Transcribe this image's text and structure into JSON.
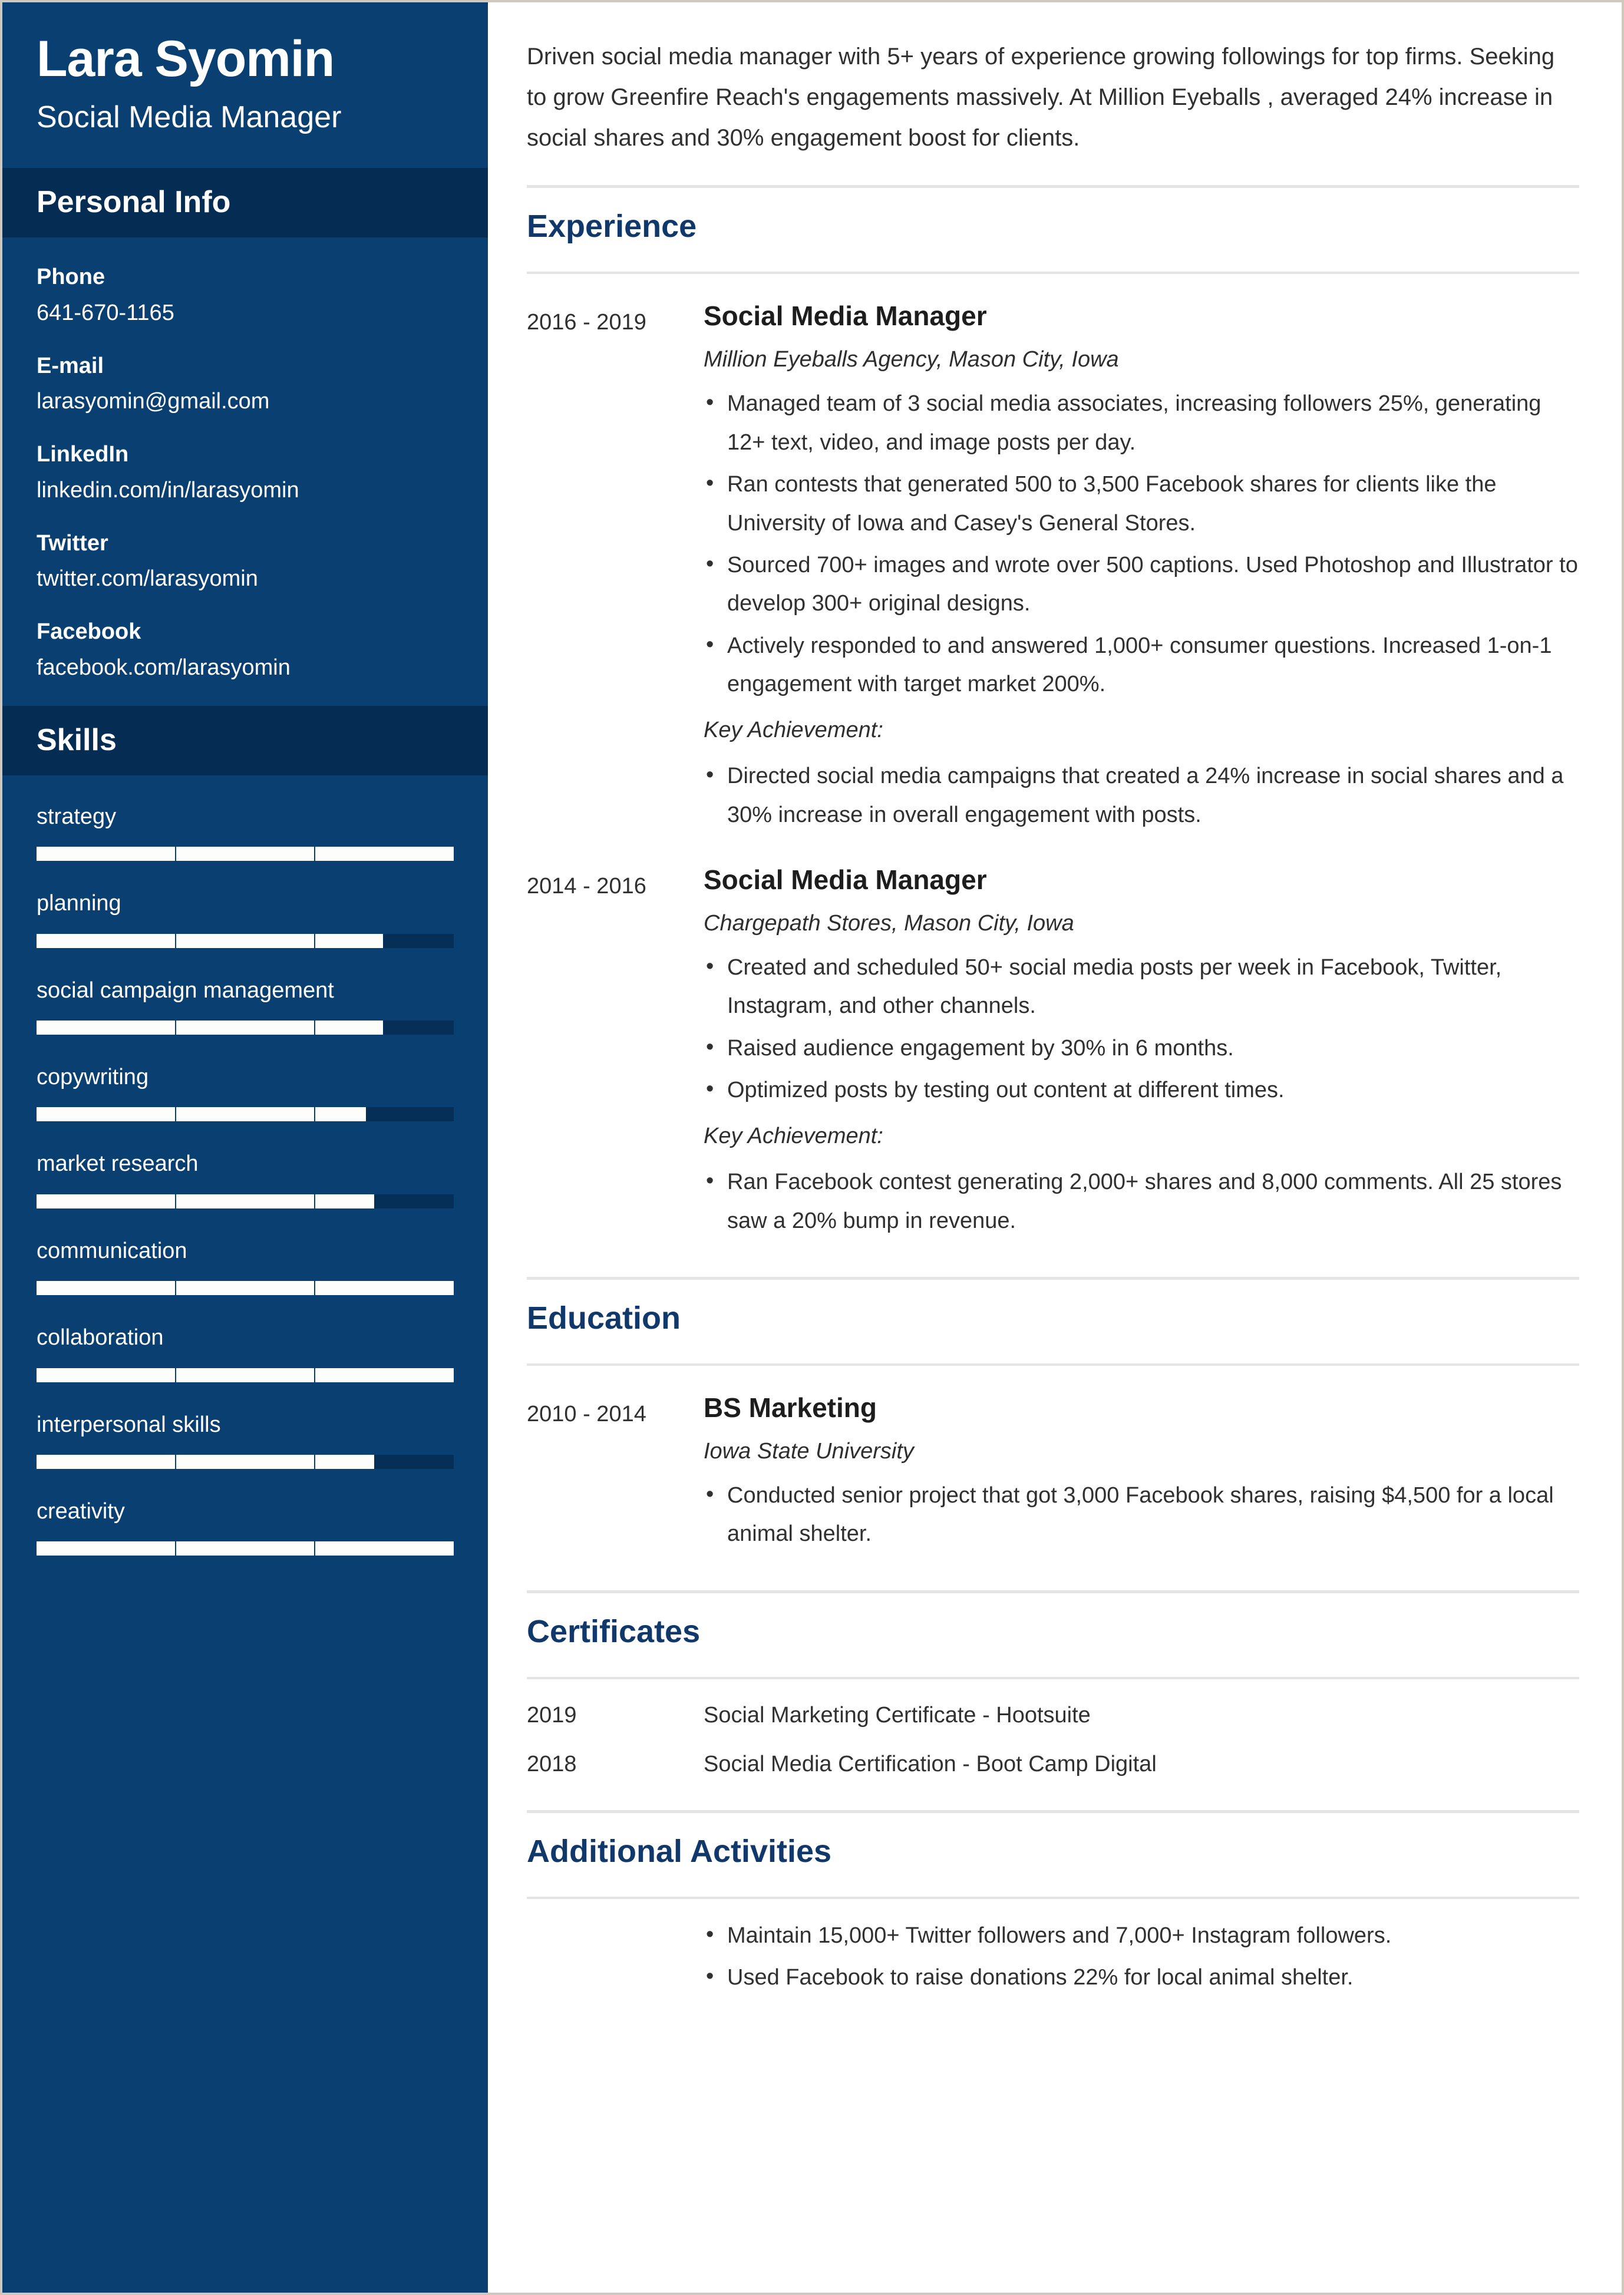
{
  "profile": {
    "name": "Lara Syomin",
    "role": "Social Media Manager"
  },
  "sidebar": {
    "personal_info_title": "Personal Info",
    "skills_title": "Skills",
    "contacts": [
      {
        "label": "Phone",
        "value": "641-670-1165"
      },
      {
        "label": "E-mail",
        "value": "larasyomin@gmail.com"
      },
      {
        "label": "LinkedIn",
        "value": "linkedin.com/in/larasyomin"
      },
      {
        "label": "Twitter",
        "value": "twitter.com/larasyomin"
      },
      {
        "label": "Facebook",
        "value": "facebook.com/larasyomin"
      }
    ],
    "skills": [
      {
        "name": "strategy",
        "level": 100
      },
      {
        "name": "planning",
        "level": 83
      },
      {
        "name": "social campaign management",
        "level": 83
      },
      {
        "name": "copywriting",
        "level": 79
      },
      {
        "name": "market research",
        "level": 81
      },
      {
        "name": "communication",
        "level": 100
      },
      {
        "name": "collaboration",
        "level": 100
      },
      {
        "name": "interpersonal skills",
        "level": 81
      },
      {
        "name": "creativity",
        "level": 100
      }
    ]
  },
  "main": {
    "summary": "Driven social media manager with 5+ years of experience growing followings for top firms. Seeking to grow Greenfire Reach's engagements massively. At Million Eyeballs , averaged 24% increase in social shares and 30% engagement boost for clients.",
    "experience_title": "Experience",
    "education_title": "Education",
    "certificates_title": "Certificates",
    "activities_title": "Additional Activities",
    "experience": [
      {
        "dates": "2016 - 2019",
        "title": "Social Media Manager",
        "subtitle": "Million Eyeballs Agency, Mason City, Iowa",
        "bullets": [
          "Managed team of 3 social media associates, increasing followers 25%, generating 12+ text, video, and image posts per day.",
          "Ran contests that generated 500 to 3,500 Facebook shares for clients like the University of Iowa and Casey's General Stores.",
          "Sourced 700+ images and wrote over 500 captions. Used Photoshop and Illustrator to develop 300+ original designs.",
          "Actively responded to and answered 1,000+ consumer questions. Increased 1-on-1 engagement with target market 200%."
        ],
        "key_achievement_label": "Key Achievement:",
        "key_achievements": [
          "Directed social media campaigns that created a 24% increase in social shares and a 30% increase in overall engagement with posts."
        ]
      },
      {
        "dates": "2014 - 2016",
        "title": "Social Media Manager",
        "subtitle": "Chargepath Stores, Mason City, Iowa",
        "bullets": [
          "Created and scheduled 50+ social media posts per week in Facebook, Twitter, Instagram, and other channels.",
          "Raised audience engagement by 30% in 6 months.",
          "Optimized posts by testing out content at different times."
        ],
        "key_achievement_label": "Key Achievement:",
        "key_achievements": [
          "Ran Facebook contest generating 2,000+ shares and 8,000 comments. All 25 stores saw a 20% bump in revenue."
        ]
      }
    ],
    "education": [
      {
        "dates": "2010 - 2014",
        "title": "BS Marketing",
        "subtitle": "Iowa State University",
        "bullets": [
          "Conducted senior project that got 3,000 Facebook shares, raising $4,500 for a local animal shelter."
        ]
      }
    ],
    "certificates": [
      {
        "year": "2019",
        "name": "Social Marketing Certificate - Hootsuite"
      },
      {
        "year": "2018",
        "name": "Social Media Certification - Boot Camp Digital"
      }
    ],
    "activities": [
      "Maintain 15,000+ Twitter followers and 7,000+ Instagram followers.",
      "Used Facebook to raise donations 22% for local animal shelter."
    ]
  },
  "colors": {
    "sidebar_blue": "#0a3f72",
    "sidebar_header_blue": "#052c52",
    "accent_heading": "#10386b",
    "bar_fill": "#fdfdfb",
    "rule_gray": "#e4e4e4"
  }
}
